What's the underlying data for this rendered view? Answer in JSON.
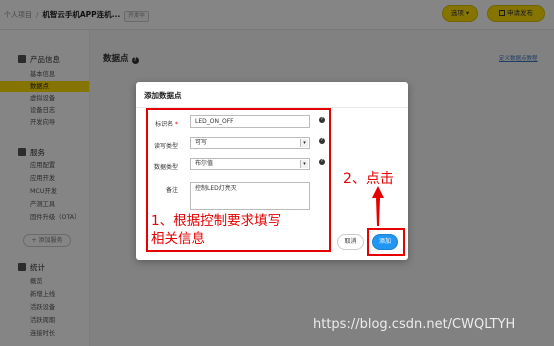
{
  "topbar": {
    "breadcrumb_root": "个人项目",
    "separator": "/",
    "project_name": "机智云手机APP连机...",
    "project_badge": "开发中",
    "options_label": "选项 ▾",
    "publish_label": "申请发布"
  },
  "sidebar": {
    "sections": [
      {
        "title": "产品信息",
        "icon": "product-info-icon",
        "items": [
          "基本信息",
          "数据点",
          "虚拟设备",
          "设备日志",
          "开发向导"
        ]
      },
      {
        "title": "服务",
        "icon": "service-icon",
        "items": [
          "应用配置",
          "应用开发",
          "MCU开发",
          "产测工具",
          "固件升级（OTA）"
        ]
      },
      {
        "title": "统计",
        "icon": "stats-icon",
        "items": [
          "概览",
          "新增上线",
          "活跃设备",
          "活跃周期",
          "连接时长"
        ]
      }
    ],
    "active_item": "数据点",
    "add_service_label": "+ 添加服务"
  },
  "main": {
    "title": "数据点",
    "help_glyph": "?",
    "guide_link": "定义数据点教程"
  },
  "modal": {
    "title": "添加数据点",
    "fields": {
      "identifier": {
        "label": "标识名",
        "required_mark": "*",
        "value": "LED_ON_OFF"
      },
      "rw_type": {
        "label": "读写类型",
        "value": "可写"
      },
      "data_type": {
        "label": "数据类型",
        "value": "布尔值"
      },
      "remark": {
        "label": "备注",
        "value": "控制LED灯亮灭"
      }
    },
    "cancel_label": "取消",
    "add_label": "添加",
    "dropdown_glyph": "▾"
  },
  "annotations": {
    "fill_note": "1、根据控制要求填写\n相关信息",
    "click_note": "2、点击",
    "color": "#e60000"
  },
  "watermark": "https://blog.csdn.net/CWQLTYH"
}
